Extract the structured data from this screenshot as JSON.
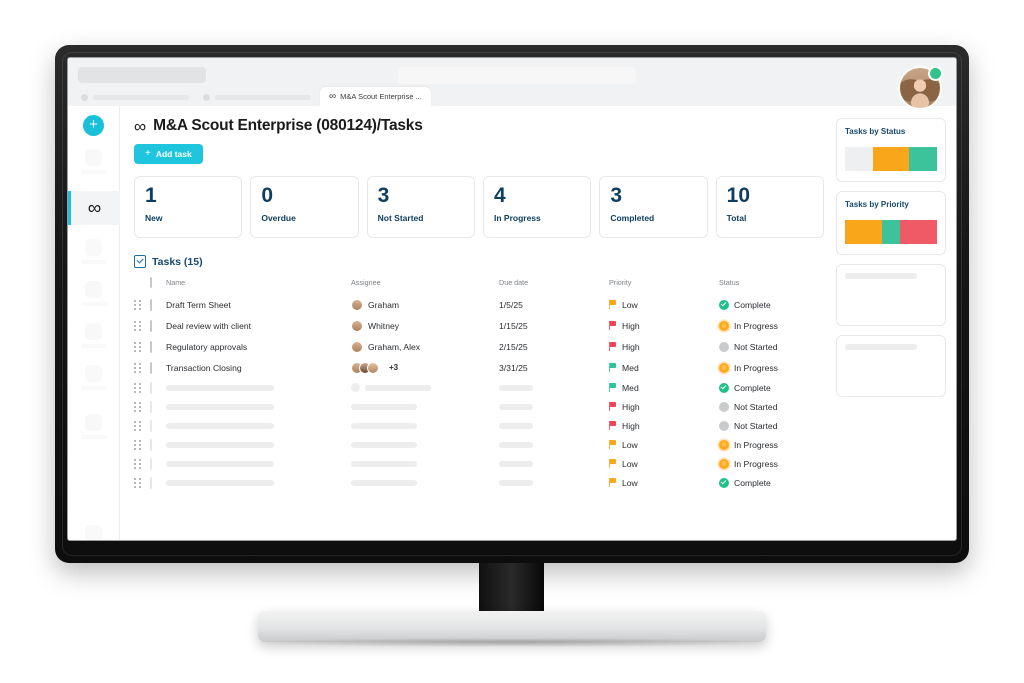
{
  "browser": {
    "active_tab": {
      "label": "M&A Scout Enterprise ...",
      "icon": "infinity-icon"
    },
    "avatar": {
      "name": "user-avatar",
      "status": "online"
    }
  },
  "sidebar": {
    "add_button_label": "+",
    "active_item": {
      "label": "∞",
      "icon": "infinity-icon"
    }
  },
  "header": {
    "title": "M&A Scout Enterprise (080124)/Tasks",
    "title_icon": "∞",
    "add_task_label": "Add task",
    "add_task_plus": "+"
  },
  "stats": [
    {
      "value": "1",
      "label": "New"
    },
    {
      "value": "0",
      "label": "Overdue"
    },
    {
      "value": "3",
      "label": "Not Started"
    },
    {
      "value": "4",
      "label": "In Progress"
    },
    {
      "value": "3",
      "label": "Completed"
    },
    {
      "value": "10",
      "label": "Total"
    }
  ],
  "tasks_section": {
    "heading": "Tasks (15)",
    "columns": [
      "Name",
      "Assignee",
      "Due date",
      "Priority",
      "Status"
    ],
    "rows": [
      {
        "name": "Draft Term Sheet",
        "assignee": "Graham",
        "avatars": 1,
        "extra": "",
        "due": "1/5/25",
        "priority": "Low",
        "priority_color": "#faa61a",
        "status": "Complete",
        "status_kind": "complete",
        "placeholder": false
      },
      {
        "name": "Deal review with client",
        "assignee": "Whitney",
        "avatars": 1,
        "extra": "",
        "due": "1/15/25",
        "priority": "High",
        "priority_color": "#ef4655",
        "status": "In Progress",
        "status_kind": "inprogress",
        "placeholder": false
      },
      {
        "name": "Regulatory approvals",
        "assignee": "Graham, Alex",
        "avatars": 1,
        "extra": "",
        "due": "2/15/25",
        "priority": "High",
        "priority_color": "#ef4655",
        "status": "Not Started",
        "status_kind": "notstarted",
        "placeholder": false
      },
      {
        "name": "Transaction Closing",
        "assignee": "",
        "avatars": 3,
        "extra": "+3",
        "due": "3/31/25",
        "priority": "Med",
        "priority_color": "#2ec4a0",
        "status": "In Progress",
        "status_kind": "inprogress",
        "placeholder": false
      },
      {
        "name": "",
        "assignee": "",
        "avatars": 0,
        "extra": "",
        "due": "",
        "priority": "Med",
        "priority_color": "#2ec4a0",
        "status": "Complete",
        "status_kind": "complete",
        "placeholder": true
      },
      {
        "name": "",
        "assignee": "",
        "avatars": 0,
        "extra": "",
        "due": "",
        "priority": "High",
        "priority_color": "#ef4655",
        "status": "Not Started",
        "status_kind": "notstarted",
        "placeholder": true
      },
      {
        "name": "",
        "assignee": "",
        "avatars": 0,
        "extra": "",
        "due": "",
        "priority": "High",
        "priority_color": "#ef4655",
        "status": "Not Started",
        "status_kind": "notstarted",
        "placeholder": true
      },
      {
        "name": "",
        "assignee": "",
        "avatars": 0,
        "extra": "",
        "due": "",
        "priority": "Low",
        "priority_color": "#faa61a",
        "status": "In Progress",
        "status_kind": "inprogress",
        "placeholder": true
      },
      {
        "name": "",
        "assignee": "",
        "avatars": 0,
        "extra": "",
        "due": "",
        "priority": "Low",
        "priority_color": "#faa61a",
        "status": "In Progress",
        "status_kind": "inprogress",
        "placeholder": true
      },
      {
        "name": "",
        "assignee": "",
        "avatars": 0,
        "extra": "",
        "due": "",
        "priority": "Low",
        "priority_color": "#faa61a",
        "status": "Complete",
        "status_kind": "complete",
        "placeholder": true
      }
    ]
  },
  "right_sidebar": {
    "cards": [
      {
        "title": "Tasks by Status"
      },
      {
        "title": "Tasks by Priority"
      },
      {
        "title": ""
      },
      {
        "title": ""
      }
    ]
  },
  "chart_data": [
    {
      "type": "bar",
      "title": "Tasks by Status",
      "orientation": "horizontal-stacked",
      "categories": [
        "Not Started",
        "In Progress",
        "Complete"
      ],
      "values": [
        3,
        4,
        3
      ],
      "colors": [
        "#eeeff0",
        "#faa61a",
        "#3dc39b"
      ],
      "xlabel": "",
      "ylabel": "",
      "legend": "none",
      "grid": false
    },
    {
      "type": "bar",
      "title": "Tasks by Priority",
      "orientation": "horizontal-stacked",
      "categories": [
        "Low",
        "Med",
        "High"
      ],
      "values": [
        4,
        2,
        4
      ],
      "colors": [
        "#faa61a",
        "#3dc39b",
        "#ef5a66"
      ],
      "xlabel": "",
      "ylabel": "",
      "legend": "none",
      "grid": false
    }
  ]
}
